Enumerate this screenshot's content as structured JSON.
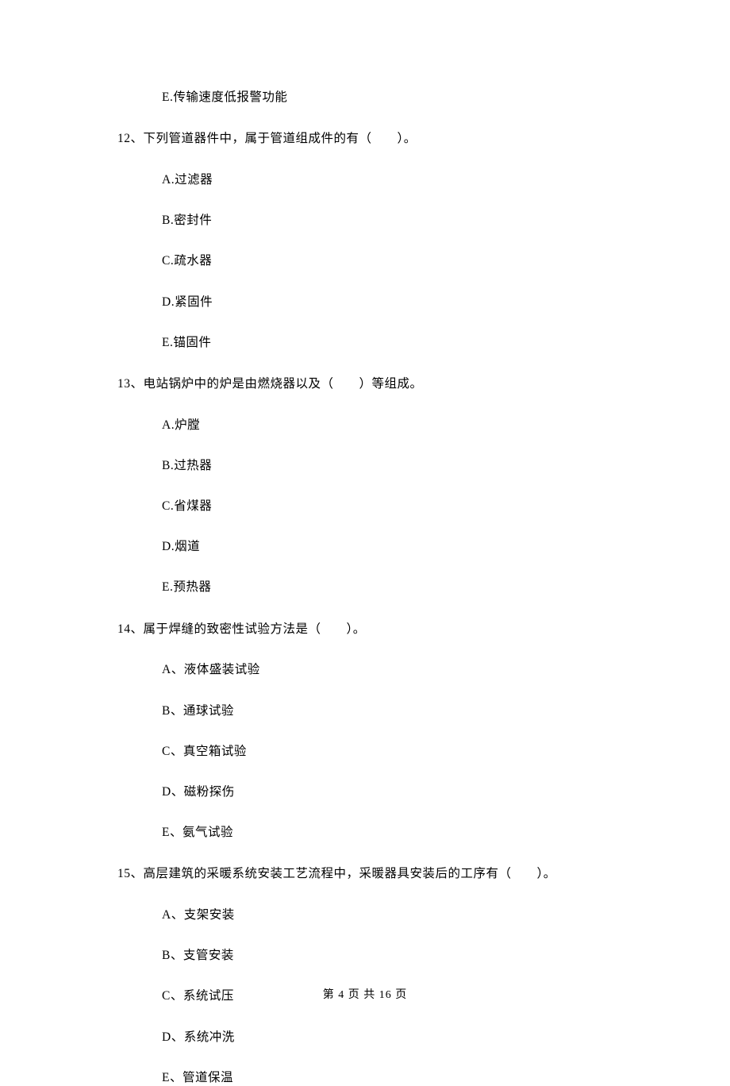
{
  "standalone_option": {
    "E": "E.传输速度低报警功能"
  },
  "questions": [
    {
      "number": "12、",
      "stem": "下列管道器件中，属于管道组成件的有（　　）。",
      "options": {
        "A": "A.过滤器",
        "B": "B.密封件",
        "C": "C.疏水器",
        "D": "D.紧固件",
        "E": "E.锚固件"
      }
    },
    {
      "number": "13、",
      "stem": "电站锅炉中的炉是由燃烧器以及（　　）等组成。",
      "options": {
        "A": "A.炉膛",
        "B": "B.过热器",
        "C": "C.省煤器",
        "D": "D.烟道",
        "E": "E.预热器"
      }
    },
    {
      "number": "14、",
      "stem": "属于焊缝的致密性试验方法是（　　）。",
      "options": {
        "A": "A、液体盛装试验",
        "B": "B、通球试验",
        "C": "C、真空箱试验",
        "D": "D、磁粉探伤",
        "E": "E、氨气试验"
      }
    },
    {
      "number": "15、",
      "stem": "高层建筑的采暖系统安装工艺流程中，采暖器具安装后的工序有（　　）。",
      "options": {
        "A": "A、支架安装",
        "B": "B、支管安装",
        "C": "C、系统试压",
        "D": "D、系统冲洗",
        "E": "E、管道保温"
      }
    }
  ],
  "footer": "第 4 页 共 16 页"
}
